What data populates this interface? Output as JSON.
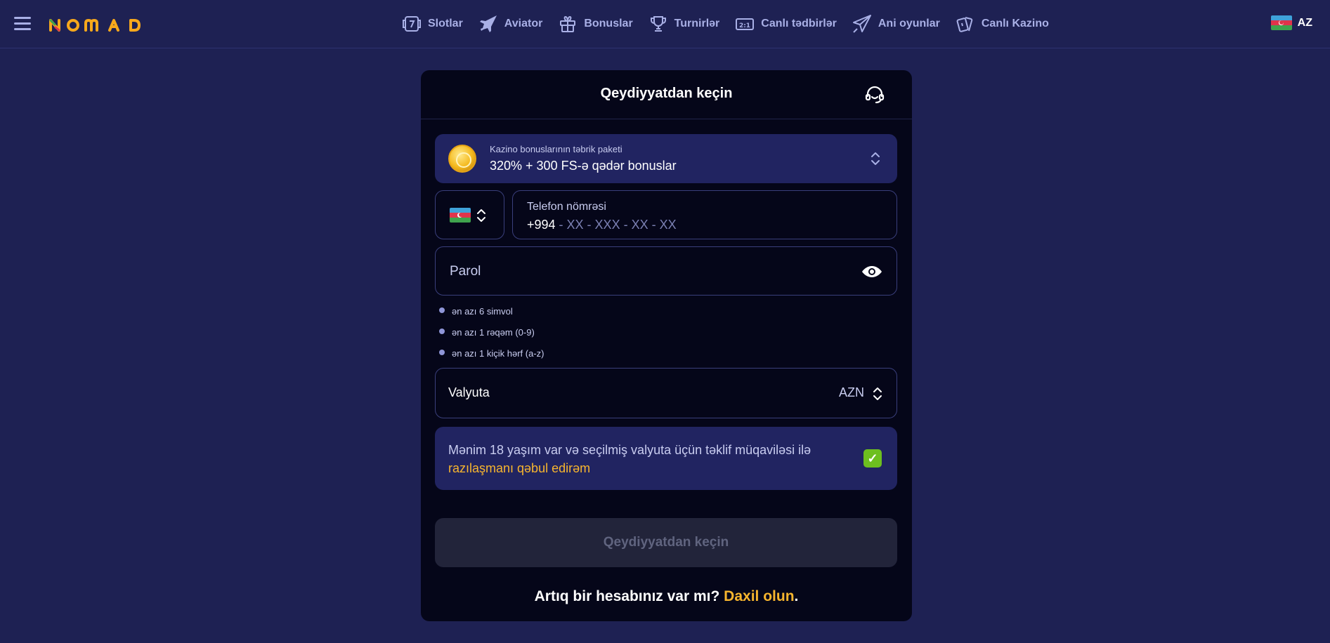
{
  "header": {
    "logo_text": "NOMAD",
    "nav": [
      {
        "label": "Slotlar",
        "icon": "slot-machine-icon"
      },
      {
        "label": "Aviator",
        "icon": "plane-icon"
      },
      {
        "label": "Bonuslar",
        "icon": "gift-icon"
      },
      {
        "label": "Turnirlər",
        "icon": "trophy-icon"
      },
      {
        "label": "Canlı tədbirlər",
        "icon": "scoreboard-icon"
      },
      {
        "label": "Ani oyunlar",
        "icon": "paper-plane-icon"
      },
      {
        "label": "Canlı Kazino",
        "icon": "cards-icon"
      }
    ],
    "language": "AZ"
  },
  "form": {
    "title": "Qeydiyyatdan keçin",
    "bonus": {
      "subtitle": "Kazino bonuslarının təbrik paketi",
      "title": "320% + 300 FS-ə qədər bonuslar"
    },
    "phone": {
      "label": "Telefon nömrəsi",
      "code": "+994",
      "mask": " - XX - XXX - XX - XX"
    },
    "password": {
      "placeholder": "Parol",
      "rules": [
        "ən azı 6 simvol",
        "ən azı 1 rəqəm (0-9)",
        "ən azı 1 kiçik hərf (a-z)"
      ]
    },
    "currency": {
      "label": "Valyuta",
      "value": "AZN"
    },
    "agreement": {
      "text": "Mənim 18 yaşım var və seçilmiş valyuta üçün təklif müqaviləsi ilə ",
      "link": "razılaşmanı qəbul edirəm",
      "checked": true,
      "check_mark": "✓"
    },
    "submit_label": "Qeydiyyatdan keçin",
    "login_prompt": "Artıq bir hesabınız var mı? ",
    "login_link": "Daxil olun",
    "login_suffix": "."
  },
  "colors": {
    "background": "#1e2153",
    "card": "#050619",
    "panel": "#212461",
    "accent_yellow": "#f7b52e",
    "checkbox_green": "#6dbf1f"
  }
}
